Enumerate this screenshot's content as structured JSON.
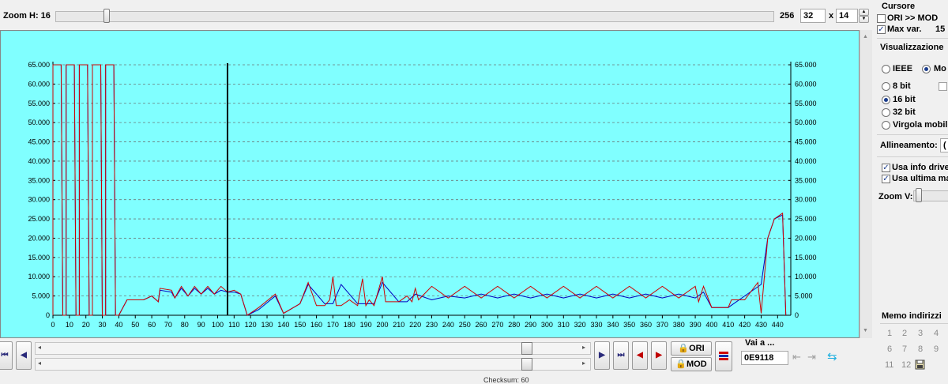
{
  "toolbar": {
    "zoom_h_label": "Zoom H: 16",
    "zoom_h_max": "256",
    "cols_value": "32",
    "times": "x",
    "rows_value": "14"
  },
  "cursore": {
    "title": "Cursore",
    "ori_mod_label": "ORI >> MOD",
    "max_var_label": "Max var.",
    "max_var_value": "15"
  },
  "visualizzazione": {
    "title": "Visualizzazione",
    "ieee_label": "IEEE",
    "mot_label": "Mo",
    "bit8_label": "8 bit",
    "bit16_label": "16 bit",
    "bit32_label": "32 bit",
    "float_label": "Virgola mobile",
    "align_label": "Allineamento:",
    "align_value": "(",
    "usa_info_label": "Usa info drive",
    "usa_ultima_label": "Usa ultima ma",
    "zoom_v_label": "Zoom V:"
  },
  "memo": {
    "title": "Memo indirizzi",
    "numbers": [
      "1",
      "2",
      "3",
      "4",
      "6",
      "7",
      "8",
      "9",
      "11",
      "12"
    ]
  },
  "bottom": {
    "ori_label": "ORI",
    "mod_label": "MOD",
    "vai_label": "Vai a ...",
    "address_value": "0E9118",
    "status_text": "Checksum: 60"
  },
  "colors": {
    "plot_bg": "#80ffff",
    "ori_line": "#0000c0",
    "mod_line": "#d00000",
    "cursor": "#000000"
  },
  "chart_data": {
    "type": "line",
    "xlim": [
      0,
      448
    ],
    "ylim": [
      0,
      65000
    ],
    "x_ticks": [
      0,
      10,
      20,
      30,
      40,
      50,
      60,
      70,
      80,
      90,
      100,
      110,
      120,
      130,
      140,
      150,
      160,
      170,
      180,
      190,
      200,
      210,
      220,
      230,
      240,
      250,
      260,
      270,
      280,
      290,
      300,
      310,
      320,
      330,
      340,
      350,
      360,
      370,
      380,
      390,
      400,
      410,
      420,
      430,
      440
    ],
    "y_ticks": [
      0,
      5000,
      10000,
      15000,
      20000,
      25000,
      30000,
      35000,
      40000,
      45000,
      50000,
      55000,
      60000,
      65000
    ],
    "y_tick_labels": [
      "0",
      "5.000",
      "10.000",
      "15.000",
      "20.000",
      "25.000",
      "30.000",
      "35.000",
      "40.000",
      "45.000",
      "50.000",
      "55.000",
      "60.000",
      "65.000"
    ],
    "grid": true,
    "cursor_x": 106,
    "series": [
      {
        "role": "ori",
        "x": [
          0,
          0,
          5,
          6,
          8,
          8,
          13,
          14,
          16,
          16,
          21,
          22,
          24,
          24,
          29,
          30,
          32,
          32,
          37,
          38,
          40,
          45,
          55,
          60,
          64,
          65,
          72,
          74,
          78,
          82,
          86,
          90,
          94,
          98,
          102,
          106,
          110,
          114,
          118,
          125,
          135,
          140,
          150,
          155,
          165,
          170,
          175,
          185,
          195,
          200,
          210,
          215,
          220,
          230,
          240,
          250,
          260,
          270,
          280,
          290,
          300,
          310,
          320,
          330,
          340,
          350,
          360,
          370,
          380,
          390,
          395,
          400,
          410,
          420,
          430,
          434,
          438,
          443,
          445
        ],
        "y": [
          0,
          65000,
          65000,
          0,
          0,
          65000,
          65000,
          0,
          0,
          65000,
          65000,
          0,
          0,
          65000,
          65000,
          0,
          0,
          65000,
          65000,
          0,
          0,
          4000,
          4000,
          5000,
          3500,
          6500,
          6000,
          4500,
          7000,
          5000,
          7000,
          5500,
          7000,
          5500,
          6500,
          6000,
          6000,
          5500,
          0,
          1500,
          5000,
          500,
          3000,
          8000,
          3000,
          3000,
          8000,
          3000,
          3000,
          8500,
          3500,
          3500,
          5500,
          4000,
          5000,
          4500,
          5500,
          4500,
          5500,
          4500,
          5500,
          4500,
          5500,
          4500,
          5500,
          4500,
          5500,
          4500,
          5500,
          4500,
          6000,
          2000,
          2000,
          5000,
          8000,
          20000,
          25000,
          26000,
          0
        ]
      },
      {
        "role": "mod",
        "x": [
          0,
          0,
          5,
          6,
          8,
          8,
          13,
          14,
          16,
          16,
          21,
          22,
          24,
          24,
          29,
          30,
          32,
          32,
          37,
          38,
          40,
          45,
          55,
          60,
          64,
          65,
          72,
          74,
          78,
          82,
          86,
          90,
          94,
          98,
          102,
          106,
          110,
          114,
          118,
          125,
          135,
          140,
          150,
          155,
          160,
          165,
          168,
          170,
          172,
          175,
          180,
          185,
          188,
          190,
          192,
          195,
          200,
          202,
          205,
          210,
          215,
          218,
          220,
          222,
          230,
          240,
          250,
          260,
          270,
          280,
          290,
          300,
          310,
          320,
          330,
          340,
          350,
          360,
          370,
          380,
          390,
          392,
          395,
          400,
          410,
          412,
          420,
          428,
          430,
          434,
          438,
          443,
          445
        ],
        "y": [
          0,
          65000,
          65000,
          0,
          0,
          65000,
          65000,
          0,
          0,
          65000,
          65000,
          0,
          0,
          65000,
          65000,
          0,
          0,
          65000,
          65000,
          0,
          0,
          4000,
          4000,
          5000,
          3500,
          7000,
          6500,
          4500,
          7500,
          5000,
          7500,
          5500,
          7500,
          5500,
          7500,
          6000,
          6500,
          5500,
          0,
          2000,
          5500,
          500,
          3000,
          8500,
          2500,
          2500,
          4000,
          10000,
          2500,
          2500,
          4000,
          2500,
          9500,
          2500,
          4000,
          2500,
          10000,
          3500,
          3500,
          3500,
          5000,
          3500,
          7000,
          4000,
          7500,
          4500,
          7500,
          4500,
          7500,
          4500,
          7500,
          4500,
          7500,
          4500,
          7500,
          4500,
          7500,
          4500,
          7500,
          4500,
          7500,
          3500,
          7500,
          2000,
          2000,
          4000,
          4000,
          8500,
          500,
          20000,
          25000,
          26500,
          0
        ]
      }
    ]
  }
}
